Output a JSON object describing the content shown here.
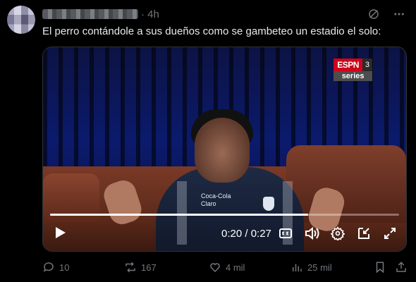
{
  "tweet": {
    "time": "· 4h",
    "text": "El perro contándole a sus dueños como se gambeteo un estadio el solo:"
  },
  "video": {
    "broadcaster": {
      "brand": "ESPN",
      "channel": "3",
      "sub": "series"
    },
    "jacket_text": {
      "line1": "Coca-Cola",
      "line2": "Claro"
    },
    "progress": 0.74,
    "time_display": "0:20 / 0:27"
  },
  "actions": {
    "replies": "10",
    "reposts": "167",
    "likes": "4 mil",
    "views": "25 mil"
  },
  "icons": {
    "grok": "grok-icon",
    "more": "more-icon",
    "play": "play-icon",
    "captions": "captions-icon",
    "volume": "volume-icon",
    "settings": "settings-icon",
    "pip": "pip-icon",
    "fullscreen": "fullscreen-icon",
    "reply": "reply-icon",
    "repost": "repost-icon",
    "like": "heart-icon",
    "views": "views-icon",
    "bookmark": "bookmark-icon",
    "share": "share-icon"
  },
  "colors": {
    "background": "#000000",
    "text": "#e7e9ea",
    "muted": "#71767b",
    "espn_red": "#d0021b"
  }
}
